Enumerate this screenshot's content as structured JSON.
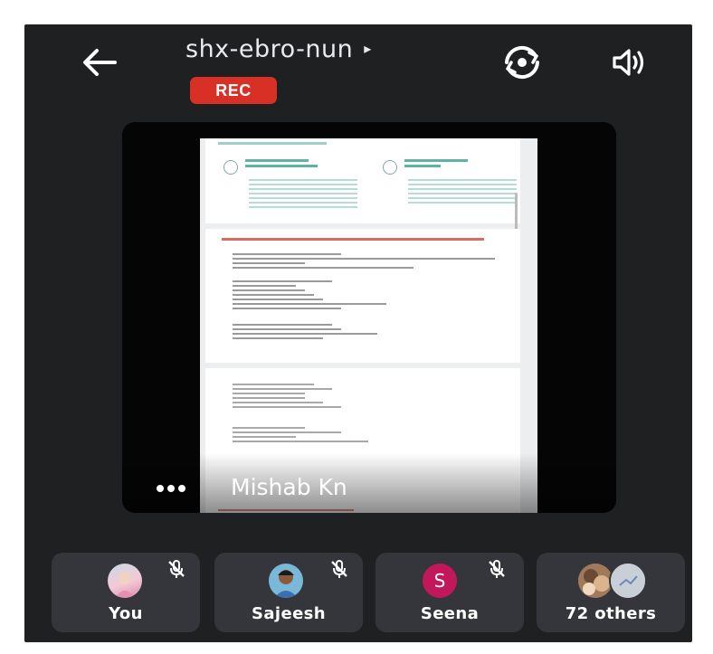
{
  "header": {
    "meeting_code": "shx-ebro-nun",
    "caret": "▸",
    "rec_label": "REC"
  },
  "icons": {
    "back": "arrow-left-icon",
    "flip": "camera-flip-icon",
    "audio": "speaker-icon",
    "more": "more-options-icon",
    "mic_off": "mic-off-icon"
  },
  "main_tile": {
    "presenter_name": "Mishab Kn"
  },
  "participants": [
    {
      "label": "You",
      "avatar": "photo"
    },
    {
      "label": "Sajeesh",
      "avatar": "photo"
    },
    {
      "label": "Seena",
      "avatar_letter": "S",
      "avatar_color": "#c2185b"
    },
    {
      "label": "72 others",
      "avatar": "stacked-photos"
    }
  ],
  "colors": {
    "background": "#1f2022",
    "tile": "#34363b",
    "rec": "#d93025"
  }
}
